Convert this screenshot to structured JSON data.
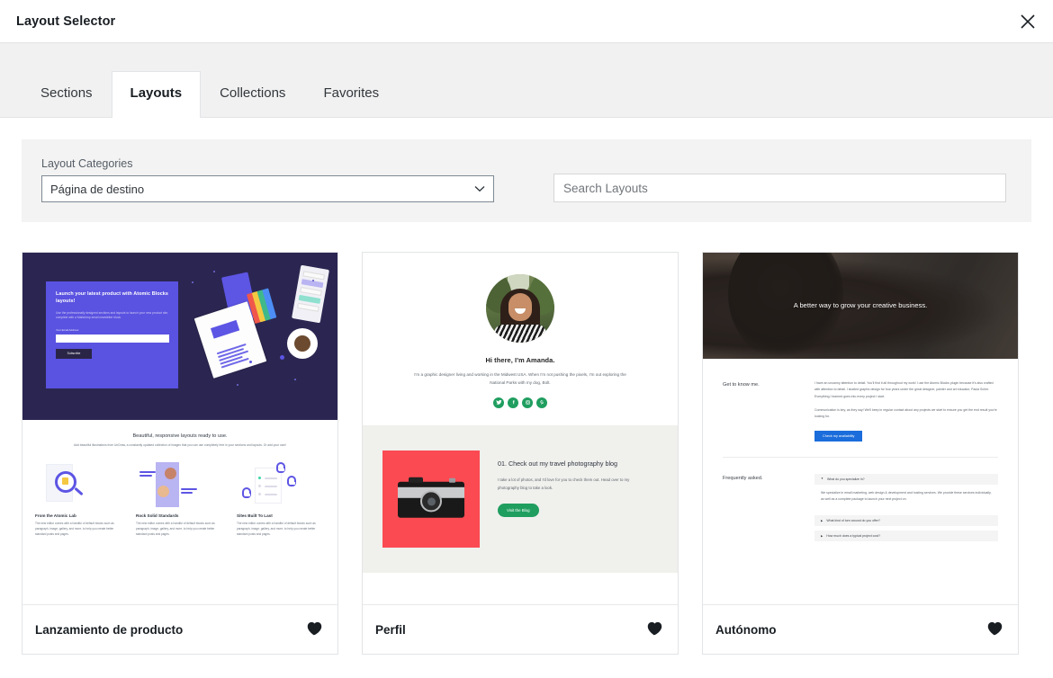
{
  "header": {
    "title": "Layout Selector",
    "close_icon": "close-icon"
  },
  "tabs": [
    {
      "label": "Sections",
      "active": false
    },
    {
      "label": "Layouts",
      "active": true
    },
    {
      "label": "Collections",
      "active": false
    },
    {
      "label": "Favorites",
      "active": false
    }
  ],
  "filters": {
    "category_label": "Layout Categories",
    "category_value": "Página de destino",
    "category_options": [
      "Página de destino"
    ],
    "search_placeholder": "Search Layouts",
    "search_value": "",
    "dropdown_icon": "chevron-down-icon"
  },
  "cards": [
    {
      "name": "Lanzamiento de producto",
      "favorite_icon": "heart-icon",
      "thumb": {
        "hero_heading": "Launch your latest product with Atomic Blocks layouts!",
        "hero_paragraph": "Use the professionally designed sections and layouts to launch your new product site, complete with a Mailchimp email newsletter block.",
        "hero_field_label": "Your Email Address:",
        "hero_button": "Subscribe",
        "lower_heading": "Beautiful, responsive layouts ready to use.",
        "lower_paragraph": "Add beautiful illustrations from UnDraw, a constantly updated collection of images that you can use completely free in your sections and layouts. Or add your own!",
        "columns": [
          {
            "heading": "From the Atomic Lab",
            "text": "The new editor comes with a handful of default blocks such as paragraph, image, gallery, and more, to help you create better standard posts and pages."
          },
          {
            "heading": "Rock Solid Standards",
            "text": "The new editor comes with a handful of default blocks such as paragraph, image, gallery, and more, to help you create better standard posts and pages."
          },
          {
            "heading": "Sites Built To Last",
            "text": "The new editor comes with a handful of default blocks such as paragraph, image, gallery, and more, to help you create better standard posts and pages."
          }
        ]
      }
    },
    {
      "name": "Perfil",
      "favorite_icon": "heart-icon",
      "thumb": {
        "heading": "Hi there, I'm Amanda.",
        "paragraph": "I'm a graphic designer living and working in the Midwest USA. When I'm not pushing the pixels, I'm out exploring the National Parks with my dog, Bolt.",
        "social": [
          "twitter-icon",
          "facebook-icon",
          "instagram-icon",
          "pinterest-icon"
        ],
        "section_heading": "01. Check out my travel photography blog",
        "section_paragraph": "I take a lot of photos, and I'd love for you to check them out. Head over to my photography blog to take a look.",
        "section_button": "Visit the Blog"
      }
    },
    {
      "name": "Autónomo",
      "favorite_icon": "heart-icon",
      "thumb": {
        "hero_heading": "A better way to grow your creative business.",
        "about_label": "Get to know me.",
        "about_paragraph_1": "I have an uncanny attention to detail. You'll find it all throughout my work! I use the Atomic Blocks plugin because it's also crafted with attention to detail. I studied graphic design for four years under the great designer, painter and art educator, Paula Scher. Everything I learned goes into every project I start.",
        "about_paragraph_2": "Communication is key, as they say! We'll keep in regular contact about any projects we start to ensure you get the end result you're looking for.",
        "about_button": "Check my availability",
        "faq_label": "Frequently asked.",
        "faq": [
          {
            "question": "What do you specialize in?",
            "answer": "We specialize in email marketing, web design & development and hosting services. We provide these services individually, as well as a complete package to launch your next project on.",
            "open": true
          },
          {
            "question": "What kind of turn around do you offer?",
            "answer": "",
            "open": false
          },
          {
            "question": "How much does a typical project cost?",
            "answer": "",
            "open": false
          }
        ]
      }
    }
  ],
  "colors": {
    "accent_purple": "#5a52e0",
    "hero_navy": "#2b2651",
    "green": "#1f9e5f",
    "blue": "#1b6ddb",
    "red": "#fb4a52",
    "panel_gray": "#f3f3f3",
    "tabbar_gray": "#f1f1f1"
  }
}
